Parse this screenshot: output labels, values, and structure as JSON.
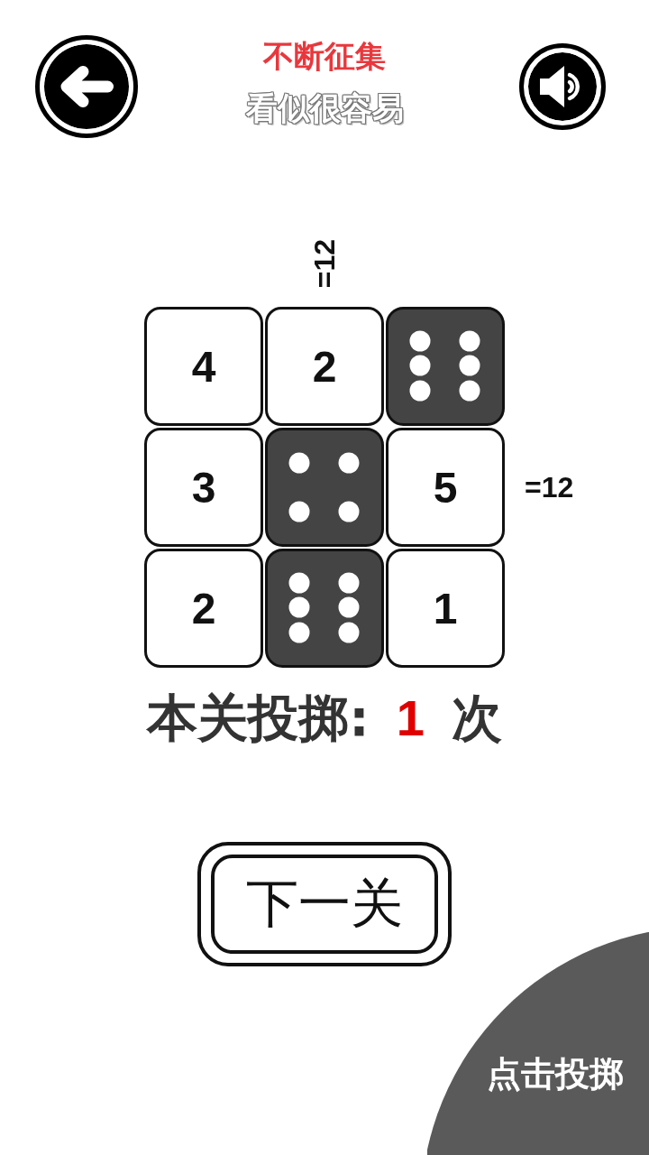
{
  "header": {
    "title": "不断征集",
    "subtitle": "看似很容易"
  },
  "sound": {
    "on": true
  },
  "board": {
    "column_sums": [
      {
        "kind": "blank"
      },
      {
        "kind": "sum",
        "text": "=12"
      },
      {
        "kind": "blank"
      }
    ],
    "rows": [
      {
        "cells": [
          {
            "kind": "number",
            "text": "4"
          },
          {
            "kind": "number",
            "text": "2"
          },
          {
            "kind": "six"
          }
        ]
      },
      {
        "cells": [
          {
            "kind": "number",
            "text": "3"
          },
          {
            "kind": "four"
          },
          {
            "kind": "number",
            "text": "5"
          },
          {
            "kind": "sum",
            "text": "=12"
          }
        ]
      },
      {
        "cells": [
          {
            "kind": "number",
            "text": "2"
          },
          {
            "kind": "six"
          },
          {
            "kind": "number",
            "text": "1"
          }
        ]
      }
    ]
  },
  "counter": {
    "label": "本关投掷:",
    "count": "1",
    "unit": "次"
  },
  "next_button": {
    "label": "下一关"
  },
  "roll_button": {
    "label": "点击投掷"
  }
}
